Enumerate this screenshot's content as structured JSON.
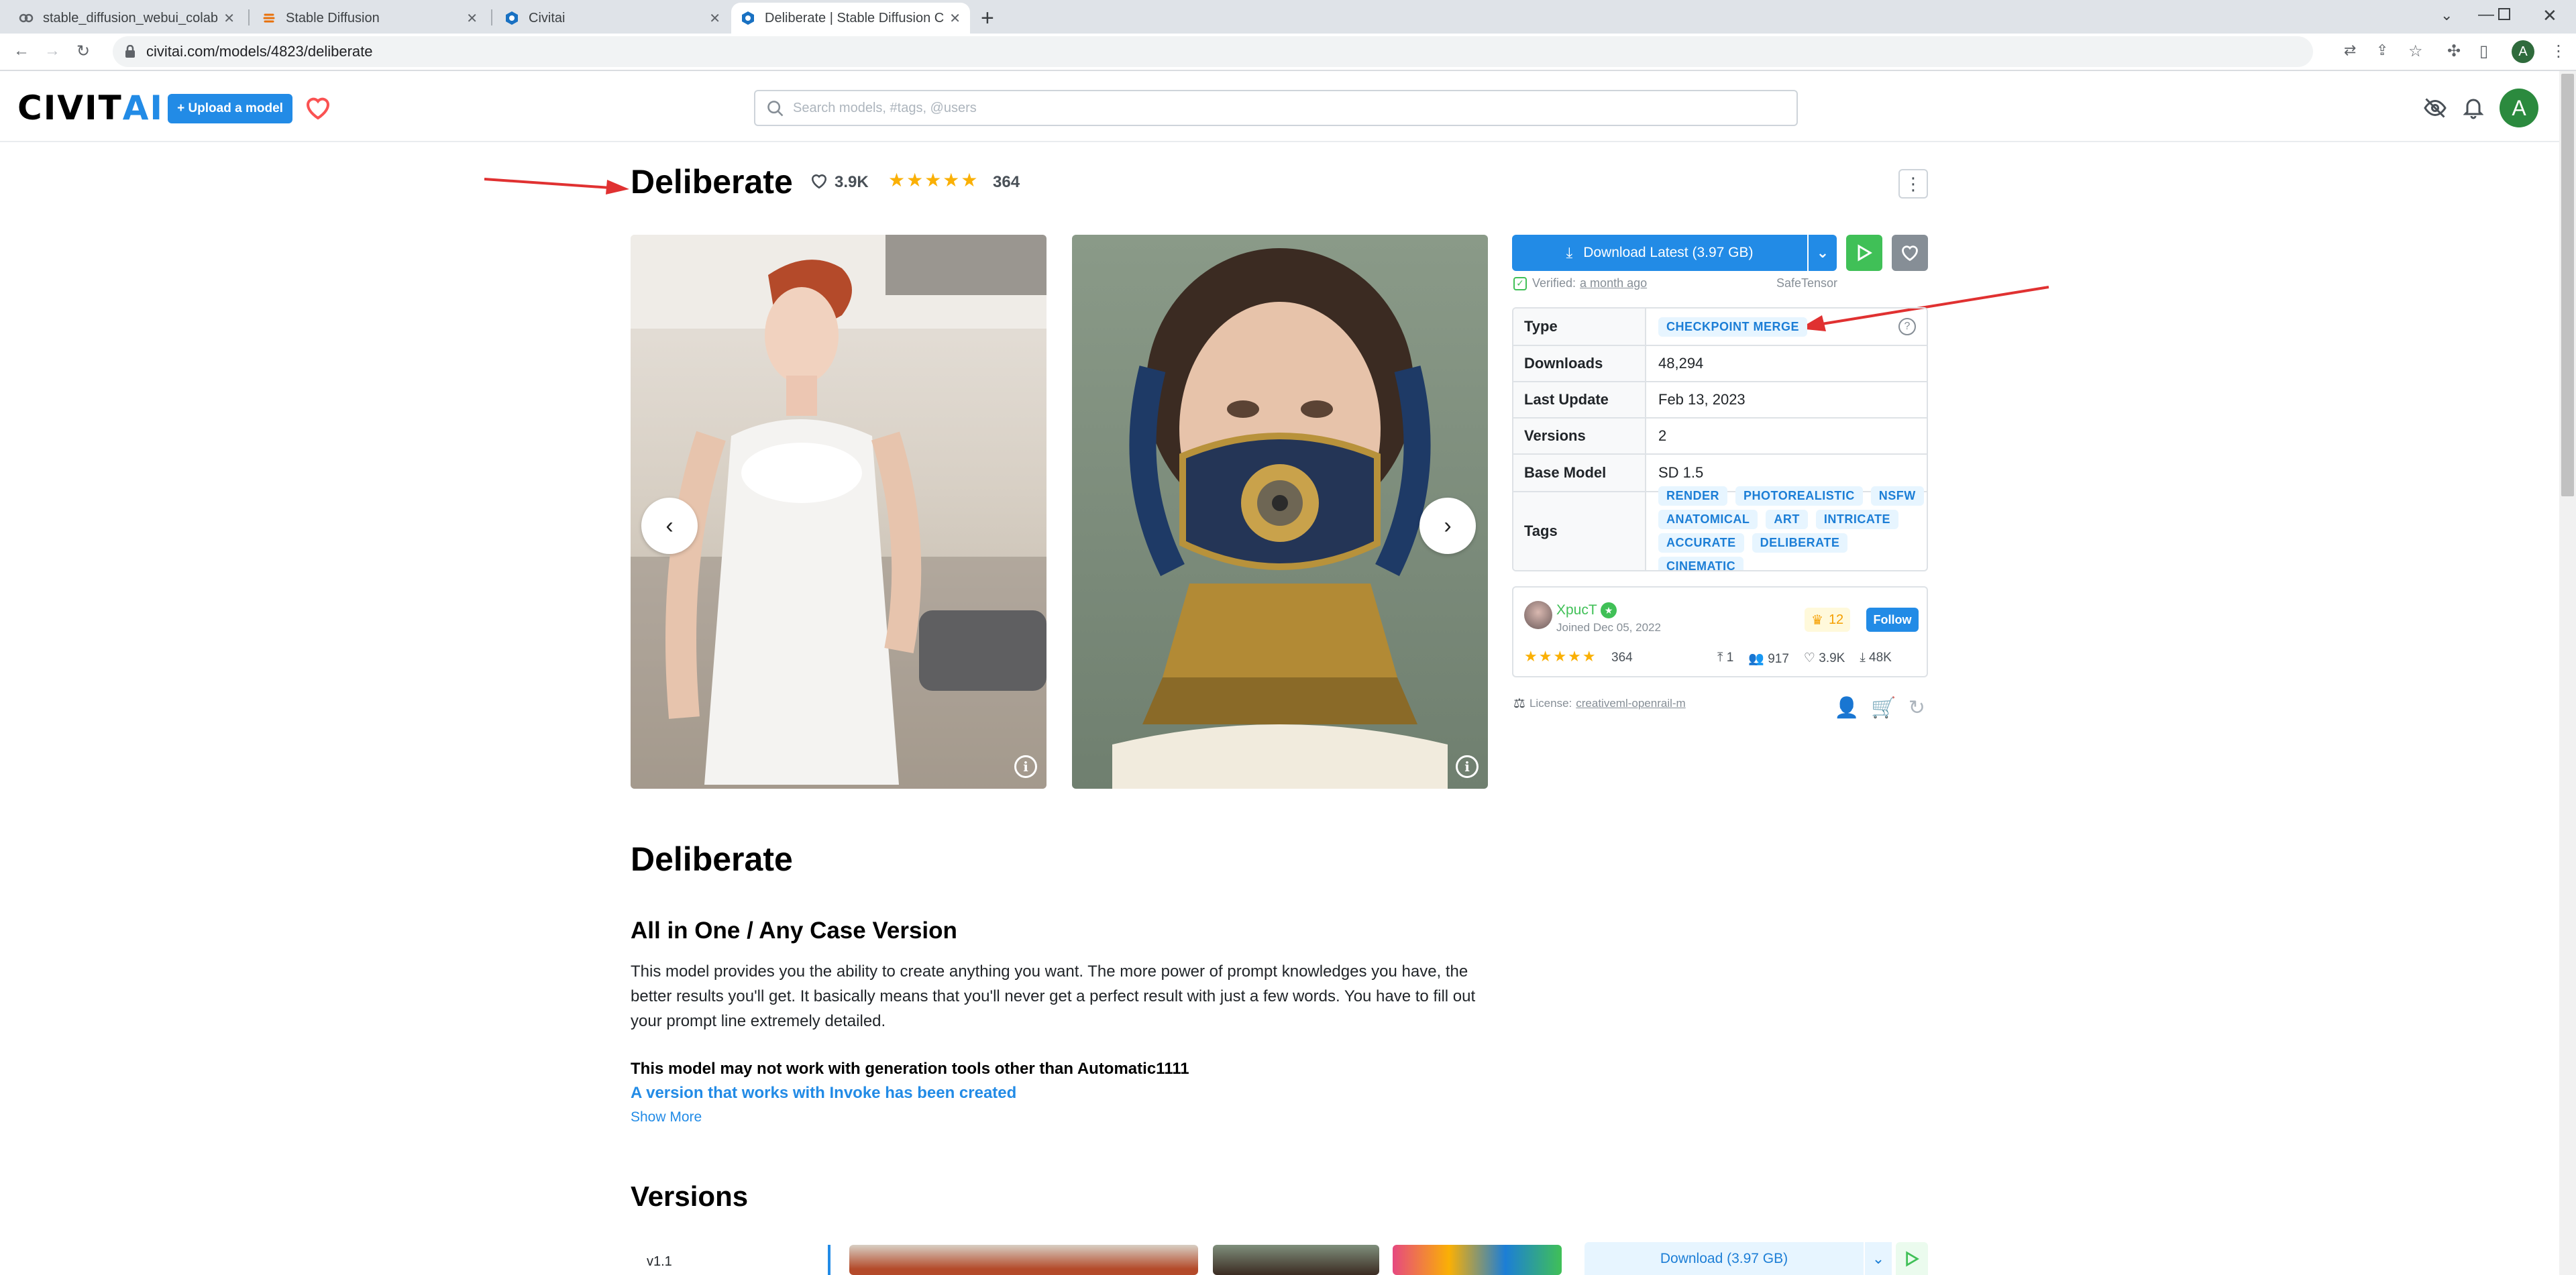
{
  "browser": {
    "tabs": [
      {
        "title": "stable_diffusion_webui_colab.ipynb",
        "icon": "colab-icon"
      },
      {
        "title": "Stable Diffusion",
        "icon": "stable-diffusion-icon"
      },
      {
        "title": "Civitai",
        "icon": "civitai-icon"
      },
      {
        "title": "Deliberate | Stable Diffusion Checkpoint | Civitai",
        "icon": "civitai-icon",
        "active": true
      }
    ],
    "new_tab": "+",
    "url": "civitai.com/models/4823/deliberate",
    "profile_initial": "A"
  },
  "header": {
    "logo_main": "CIVIT",
    "logo_accent": "AI",
    "upload_label": "+ Upload a model",
    "search_placeholder": "Search models, #tags, @users",
    "avatar_initial": "A"
  },
  "model": {
    "name": "Deliberate",
    "likes": "3.9K",
    "rating": 5,
    "rating_count": "364",
    "download_label": "Download Latest (3.97 GB)",
    "verified_label": "Verified:",
    "verified_when": "a month ago",
    "file_format": "SafeTensor",
    "details": {
      "type_label": "Type",
      "type": "CHECKPOINT MERGE",
      "downloads_label": "Downloads",
      "downloads": "48,294",
      "last_update_label": "Last Update",
      "last_update": "Feb 13, 2023",
      "versions_label": "Versions",
      "versions": "2",
      "base_model_label": "Base Model",
      "base_model": "SD 1.5",
      "tags_label": "Tags"
    },
    "tags": [
      "RENDER",
      "PHOTOREALISTIC",
      "NSFW",
      "ANATOMICAL",
      "ART",
      "INTRICATE",
      "ACCURATE",
      "DELIBERATE",
      "CINEMATIC"
    ],
    "creator": {
      "name": "XpucT",
      "joined": "Joined Dec 05, 2022",
      "crowns": "12",
      "follow_label": "Follow",
      "rating_count": "364",
      "uploads": "1",
      "followers": "917",
      "likes": "3.9K",
      "downloads": "48K"
    },
    "license_label": "License:",
    "license": "creativeml-openrail-m"
  },
  "about": {
    "title": "Deliberate",
    "subtitle": "All in One / Any Case Version",
    "paragraph": "This model provides you the ability to create anything you want. The more power of prompt knowledges you have, the better results you'll get. It basically means that you'll never get a perfect result with just a few words. You have to fill out your prompt line extremely detailed.",
    "warning": "This model may not work with generation tools other than Automatic1111",
    "invoke_link": "A version that works with Invoke has been created",
    "show_more": "Show More"
  },
  "versions": {
    "title": "Versions",
    "active_version": "v1.1",
    "download_label": "Download (3.97 GB)"
  }
}
